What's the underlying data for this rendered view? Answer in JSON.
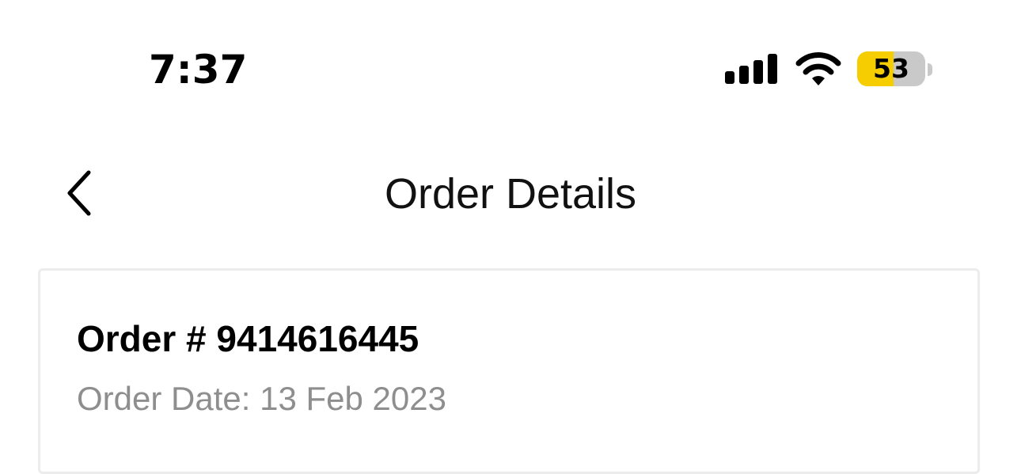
{
  "status_bar": {
    "time": "7:37",
    "battery_level": "53",
    "battery_fraction": 0.53,
    "battery_color": "#f5cd00",
    "signal_icon": "cellular-signal-icon",
    "wifi_icon": "wifi-icon"
  },
  "nav": {
    "title": "Order Details",
    "back_icon": "chevron-left-icon"
  },
  "order": {
    "number_label": "Order # 9414616445",
    "date_label": "Order Date: 13 Feb 2023"
  }
}
